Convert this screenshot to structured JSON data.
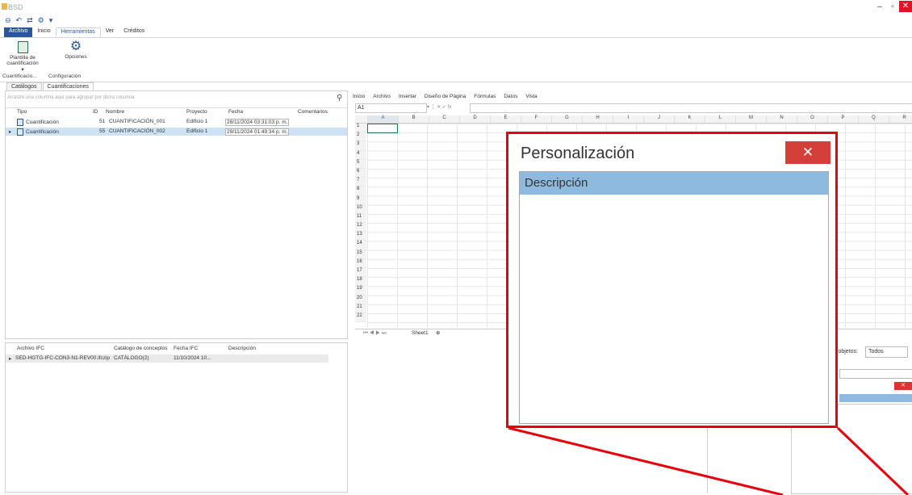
{
  "window": {
    "title": "BSD",
    "controls": [
      "–",
      "▫",
      "✕"
    ]
  },
  "quick_access": [
    "⊖",
    "↶",
    "⇄",
    "⚙",
    "▾"
  ],
  "ribbon": {
    "tabs": [
      "Archivo",
      "Inicio",
      "Herramientas",
      "Ver",
      "Créditos"
    ],
    "buttons": {
      "plantilla": "Plantilla de cuantificación ▾",
      "opciones": "Opciones"
    },
    "groups": {
      "cuantificacion": "Cuantificacio...",
      "configuracion": "Configuración"
    }
  },
  "doc_tabs": [
    "Catálogos",
    "Cuantificaciones"
  ],
  "top_grid": {
    "group_hint": "Arrastre una columna aquí para agrupar por dicha columna",
    "columns": [
      "Tipo",
      "ID",
      "Nombre",
      "Proyecto",
      "Fecha",
      "Comentarios"
    ],
    "rows": [
      {
        "tipo": "Cuantificación",
        "id": "51",
        "nombre": "CUANTIFICACIÓN_001",
        "proyecto": "Edificio 1",
        "fecha": "28/11/2024 03:31:03 p. m."
      },
      {
        "tipo": "Cuantificación",
        "id": "55",
        "nombre": "CUANTIFICACIÓN_002",
        "proyecto": "Edificio 1",
        "fecha": "29/11/2024 01:49:34 p. m."
      }
    ]
  },
  "bottom_grid": {
    "columns": [
      "Archivo IFC",
      "Catálogo de conceptos",
      "Fecha IFC",
      "Descripción"
    ],
    "rows": [
      {
        "archivo": "SED-HGTG-IFC-CON3-N1-REV00.ifczip",
        "catalogo": "CATÁLOGO(2)",
        "fecha": "11/10/2024 10..."
      }
    ]
  },
  "spreadsheet": {
    "menu": [
      "Inicio",
      "Archivo",
      "Insertar",
      "Diseño de Página",
      "Fórmulas",
      "Datos",
      "Vista"
    ],
    "name_box": "A1",
    "fx": "▾ ⋮ ✕ ✓ fx",
    "columns": [
      "A",
      "B",
      "C",
      "D",
      "E",
      "F",
      "G",
      "H",
      "I",
      "J",
      "K",
      "L",
      "M",
      "N",
      "O",
      "P",
      "Q",
      "R"
    ],
    "rows": [
      "1",
      "2",
      "3",
      "4",
      "5",
      "6",
      "7",
      "8",
      "9",
      "10",
      "11",
      "12",
      "13",
      "14",
      "15",
      "16",
      "17",
      "18",
      "19",
      "20",
      "21",
      "22"
    ],
    "sheet_tab": "Sheet1",
    "nav": "⏮ ◀ ▶ ⏭"
  },
  "right_panel": {
    "objetos_label": "s objetos:",
    "objetos_value": "Todos",
    "close": "✕"
  },
  "callout": {
    "title": "Personalización",
    "close": "✕",
    "header": "Descripción",
    "border_color": "#e8000b"
  }
}
